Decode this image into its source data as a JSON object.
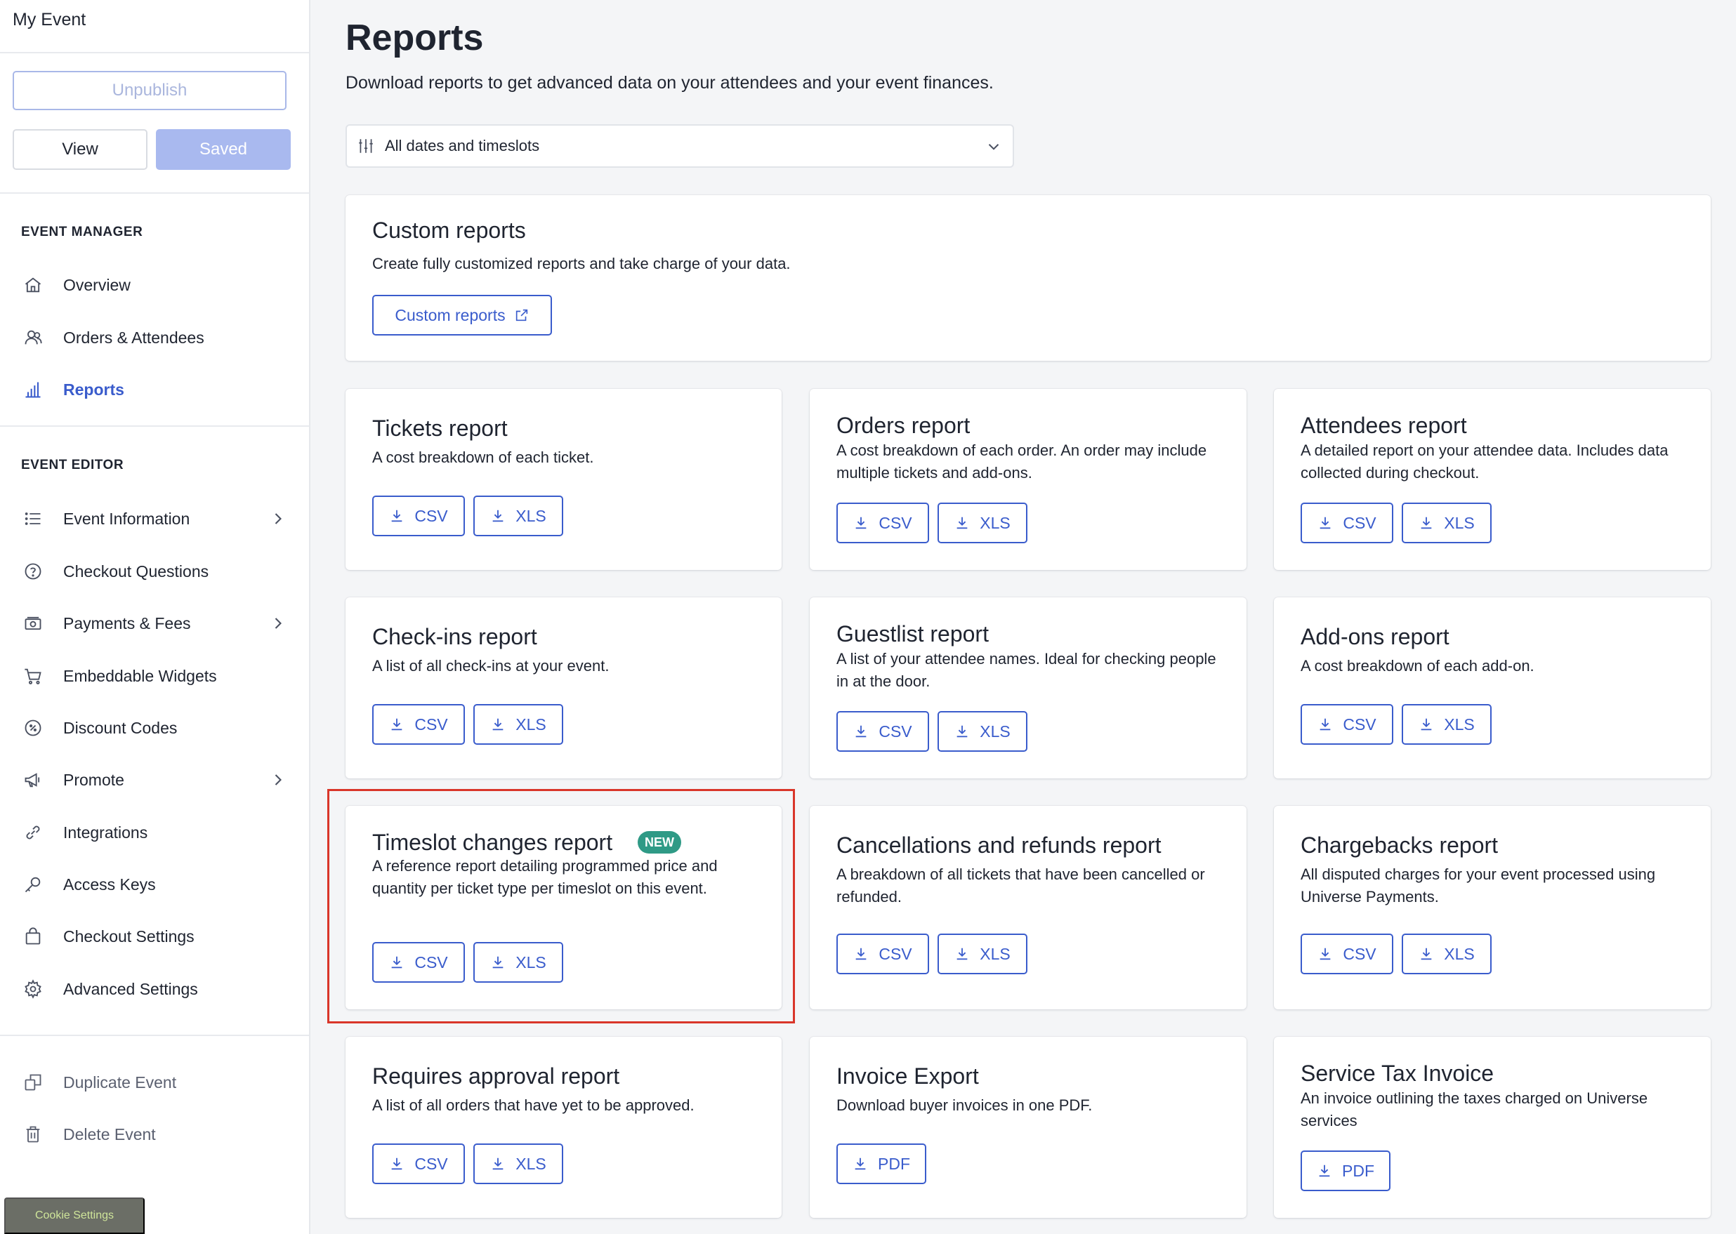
{
  "sidebar": {
    "title": "My Event",
    "unpublish_label": "Unpublish",
    "view_label": "View",
    "saved_label": "Saved",
    "manager_heading": "EVENT MANAGER",
    "manager_items": [
      {
        "label": "Overview",
        "icon": "home-icon"
      },
      {
        "label": "Orders & Attendees",
        "icon": "users-icon"
      },
      {
        "label": "Reports",
        "icon": "bar-chart-icon",
        "active": true
      }
    ],
    "editor_heading": "EVENT EDITOR",
    "editor_items": [
      {
        "label": "Event Information",
        "icon": "list-icon",
        "chevron": true
      },
      {
        "label": "Checkout Questions",
        "icon": "question-icon"
      },
      {
        "label": "Payments & Fees",
        "icon": "money-icon",
        "chevron": true
      },
      {
        "label": "Embeddable Widgets",
        "icon": "cart-icon"
      },
      {
        "label": "Discount Codes",
        "icon": "discount-icon"
      },
      {
        "label": "Promote",
        "icon": "megaphone-icon",
        "chevron": true
      },
      {
        "label": "Integrations",
        "icon": "link-icon"
      },
      {
        "label": "Access Keys",
        "icon": "key-icon"
      },
      {
        "label": "Checkout Settings",
        "icon": "bag-icon"
      },
      {
        "label": "Advanced Settings",
        "icon": "gear-icon"
      }
    ],
    "footer_items": [
      {
        "label": "Duplicate Event",
        "icon": "duplicate-icon"
      },
      {
        "label": "Delete Event",
        "icon": "trash-icon"
      }
    ],
    "cookie_label": "Cookie Settings"
  },
  "main": {
    "title": "Reports",
    "subtitle": "Download reports to get advanced data on your attendees and your event finances.",
    "filter_label": "All dates and timeslots",
    "custom": {
      "title": "Custom reports",
      "desc": "Create fully customized reports and take charge of your data.",
      "button": "Custom reports"
    },
    "reports": [
      {
        "title": "Tickets report",
        "desc": "A cost breakdown of each ticket.",
        "buttons": [
          "CSV",
          "XLS"
        ]
      },
      {
        "title": "Orders report",
        "desc": "A cost breakdown of each order. An order may include multiple tickets and add-ons.",
        "buttons": [
          "CSV",
          "XLS"
        ]
      },
      {
        "title": "Attendees report",
        "desc": "A detailed report on your attendee data. Includes data collected during checkout.",
        "buttons": [
          "CSV",
          "XLS"
        ]
      },
      {
        "title": "Check-ins report",
        "desc": "A list of all check-ins at your event.",
        "buttons": [
          "CSV",
          "XLS"
        ]
      },
      {
        "title": "Guestlist report",
        "desc": "A list of your attendee names. Ideal for checking people in at the door.",
        "buttons": [
          "CSV",
          "XLS"
        ]
      },
      {
        "title": "Add-ons report",
        "desc": "A cost breakdown of each add-on.",
        "buttons": [
          "CSV",
          "XLS"
        ]
      },
      {
        "title": "Timeslot changes report",
        "badge": "NEW",
        "desc": "A reference report detailing programmed price and quantity per ticket type per timeslot on this event.",
        "buttons": [
          "CSV",
          "XLS"
        ]
      },
      {
        "title": "Cancellations and refunds report",
        "desc": "A breakdown of all tickets that have been cancelled or refunded.",
        "buttons": [
          "CSV",
          "XLS"
        ]
      },
      {
        "title": "Chargebacks report",
        "desc": "All disputed charges for your event processed using Universe Payments.",
        "buttons": [
          "CSV",
          "XLS"
        ]
      },
      {
        "title": "Requires approval report",
        "desc": "A list of all orders that have yet to be approved.",
        "buttons": [
          "CSV",
          "XLS"
        ]
      },
      {
        "title": "Invoice Export",
        "desc": "Download buyer invoices in one PDF.",
        "buttons": [
          "PDF"
        ]
      },
      {
        "title": "Service Tax Invoice",
        "desc": "An invoice outlining the taxes charged on Universe services",
        "buttons": [
          "PDF"
        ]
      }
    ]
  },
  "colors": {
    "accent": "#3a5ccc",
    "badge": "#2f9a86",
    "highlight": "#d9362a"
  }
}
